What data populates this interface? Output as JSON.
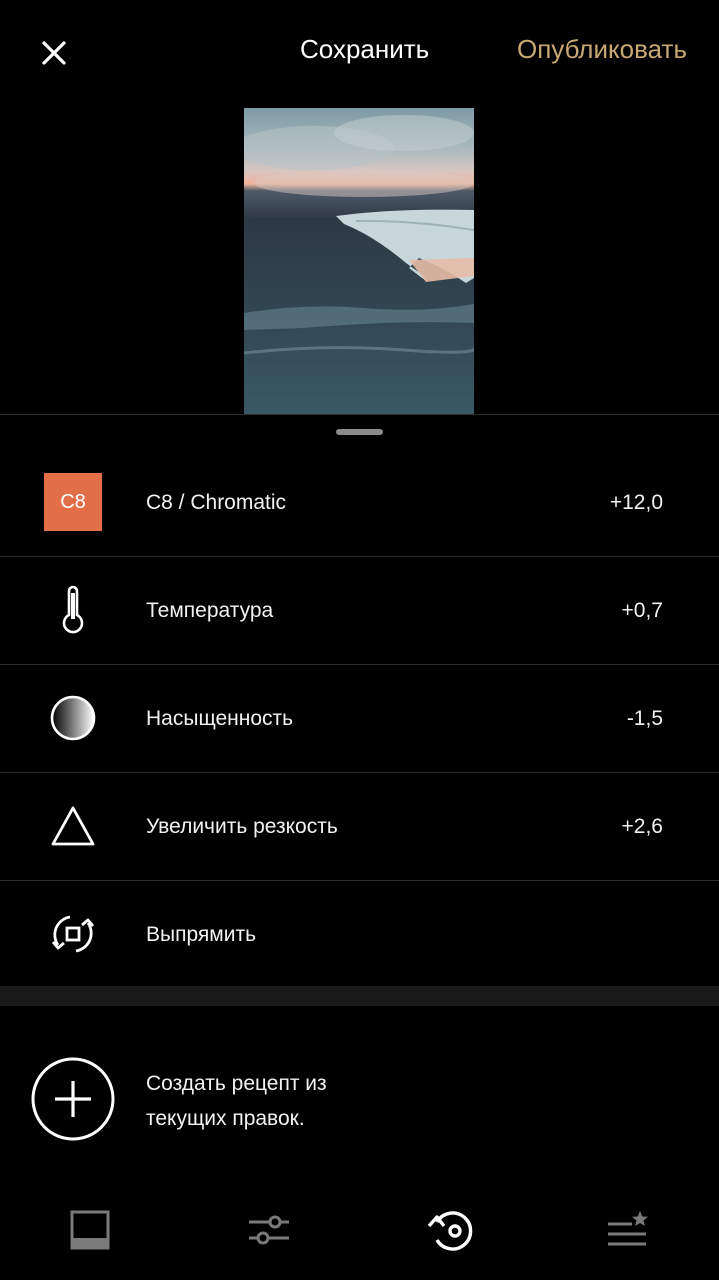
{
  "header": {
    "close_icon": "close-icon",
    "save_label": "Сохранить",
    "publish_label": "Опубликовать",
    "publish_color": "#c8a874"
  },
  "preview": {
    "description_icon": "photo-preview"
  },
  "adjustments": [
    {
      "icon": "preset-badge",
      "badge": "C8",
      "badge_color": "#e26f48",
      "label": "C8 / Chromatic",
      "value": "+12,0"
    },
    {
      "icon": "thermometer-icon",
      "label": "Температура",
      "value": "+0,7"
    },
    {
      "icon": "saturation-icon",
      "label": "Насыщенность",
      "value": "-1,5"
    },
    {
      "icon": "sharpen-triangle-icon",
      "label": "Увеличить резкость",
      "value": "+2,6"
    },
    {
      "icon": "straighten-icon",
      "label": "Выпрямить",
      "value": ""
    }
  ],
  "recipe": {
    "line1": "Создать рецепт из",
    "line2": "текущих правок."
  },
  "bottom_nav": [
    {
      "icon": "presets-icon",
      "active": false
    },
    {
      "icon": "sliders-icon",
      "active": false
    },
    {
      "icon": "history-icon",
      "active": true
    },
    {
      "icon": "recipes-icon",
      "active": false
    }
  ]
}
